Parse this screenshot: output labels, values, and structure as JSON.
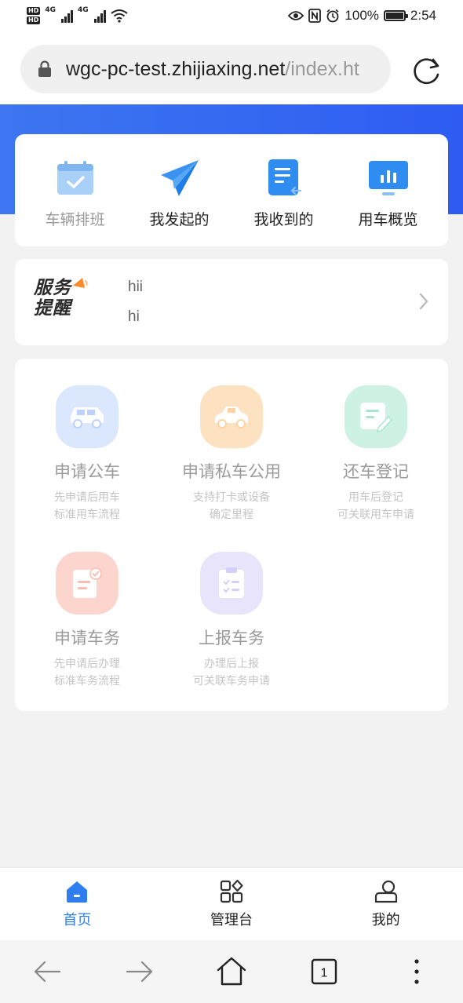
{
  "status_bar": {
    "net1": "4G",
    "net2": "4G",
    "battery": "100%",
    "time": "2:54"
  },
  "browser": {
    "url_host": "wgc-pc-test.zhijiaxing.net",
    "url_path": "/index.ht"
  },
  "quick_actions": [
    {
      "label": "车辆排班",
      "icon": "calendar-check-icon"
    },
    {
      "label": "我发起的",
      "icon": "paper-plane-icon"
    },
    {
      "label": "我收到的",
      "icon": "document-inbox-icon"
    },
    {
      "label": "用车概览",
      "icon": "chart-monitor-icon"
    }
  ],
  "notice": {
    "logo_line1": "服务",
    "logo_line2": "提醒",
    "lines": [
      "hii",
      "hi"
    ]
  },
  "services": [
    {
      "title": "申请公车",
      "sub1": "先申请后用车",
      "sub2": "标准用车流程",
      "color": "#dbe7fd",
      "icon": "car-icon"
    },
    {
      "title": "申请私车公用",
      "sub1": "支持打卡或设备",
      "sub2": "确定里程",
      "color": "#fde2c2",
      "icon": "car-icon"
    },
    {
      "title": "还车登记",
      "sub1": "用车后登记",
      "sub2": "可关联用车申请",
      "color": "#cdf2e4",
      "icon": "edit-note-icon"
    },
    {
      "title": "申请车务",
      "sub1": "先申请后办理",
      "sub2": "标准车务流程",
      "color": "#fdd5cf",
      "icon": "document-check-icon"
    },
    {
      "title": "上报车务",
      "sub1": "办理后上报",
      "sub2": "可关联车务申请",
      "color": "#e7e4fb",
      "icon": "clipboard-icon"
    }
  ],
  "tabs": [
    {
      "label": "首页",
      "icon": "home-icon",
      "active": true
    },
    {
      "label": "管理台",
      "icon": "grid-icon",
      "active": false
    },
    {
      "label": "我的",
      "icon": "user-icon",
      "active": false
    }
  ],
  "nav": {
    "tab_count": "1"
  },
  "colors": {
    "accent": "#2f7ef0",
    "hero": "#3d76f0"
  }
}
